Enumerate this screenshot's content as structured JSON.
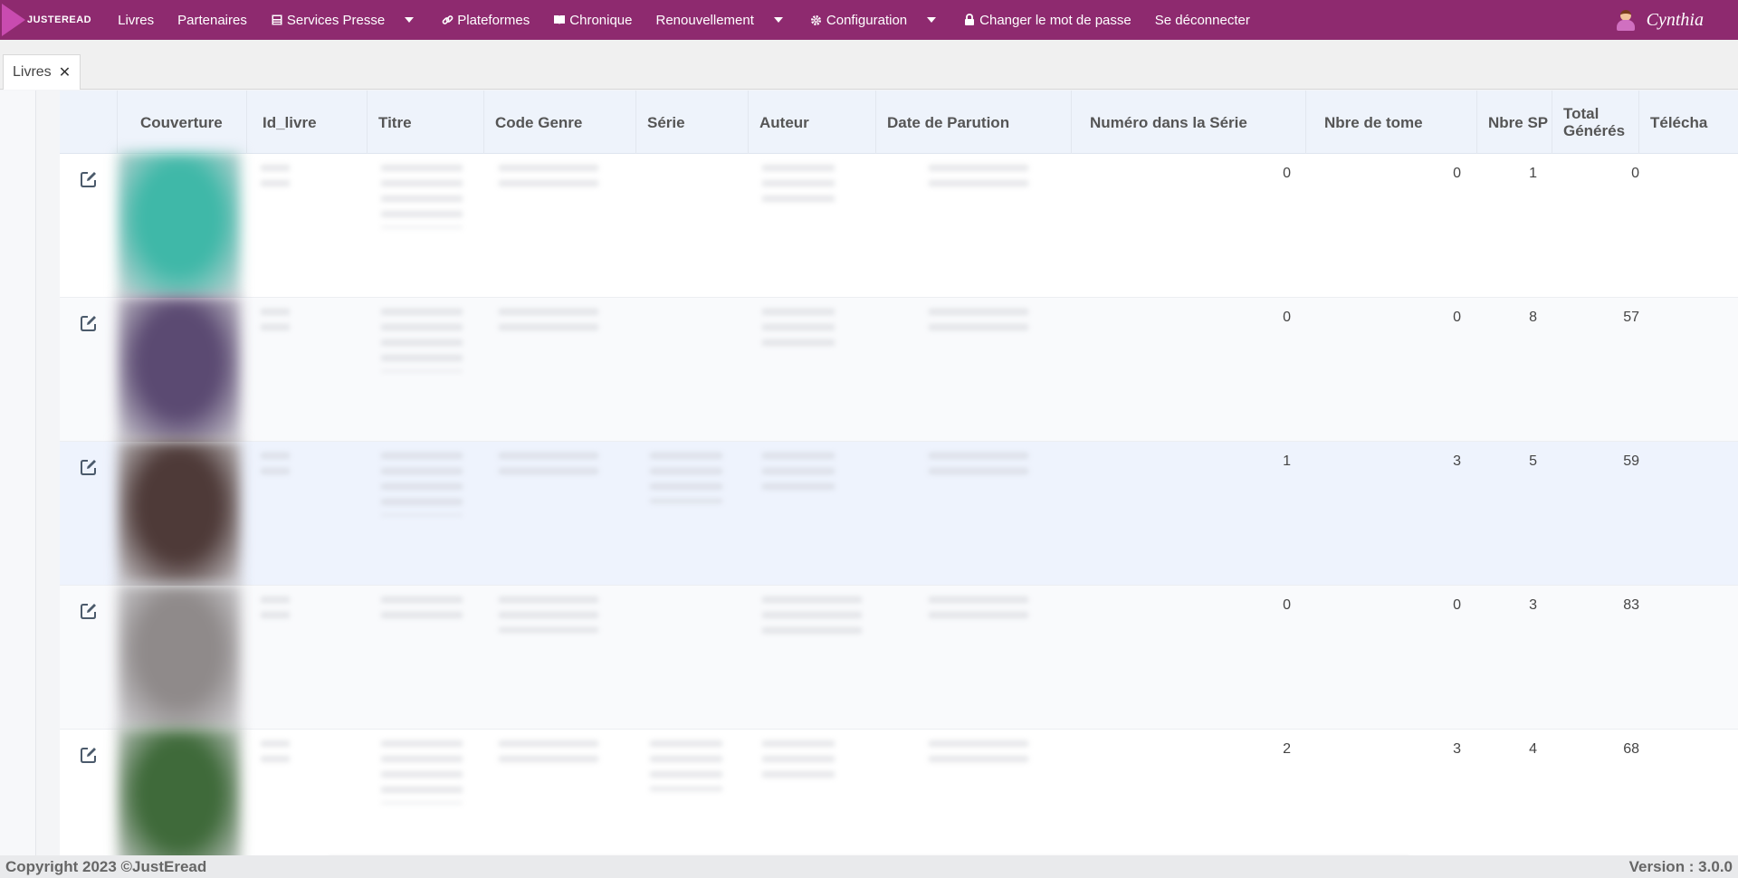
{
  "nav": {
    "logo_text": "JUSTEREAD",
    "items": [
      {
        "label": "Livres"
      },
      {
        "label": "Partenaires"
      },
      {
        "label": "Services Presse",
        "icon": "newspaper-icon",
        "dropdown": true
      },
      {
        "label": "Plateformes",
        "icon": "link-icon"
      },
      {
        "label": "Chronique",
        "icon": "book-icon"
      },
      {
        "label": "Renouvellement",
        "dropdown": true
      },
      {
        "label": "Configuration",
        "icon": "gear-icon",
        "dropdown": true
      },
      {
        "label": "Changer le mot de passe",
        "icon": "lock-icon"
      },
      {
        "label": "Se déconnecter"
      }
    ],
    "user_name": "Cynthia"
  },
  "tabs": [
    {
      "label": "Livres",
      "closable": true
    }
  ],
  "table": {
    "columns": [
      "",
      "Couverture",
      "Id_livre",
      "Titre",
      "Code Genre",
      "Série",
      "Auteur",
      "Date de Parution",
      "Numéro dans la Série",
      "Nbre de tome",
      "Nbre SP",
      "Total Générés",
      "Télécha"
    ],
    "rows": [
      {
        "numero_serie": "0",
        "nbre_tome": "0",
        "nbre_sp": "1",
        "total": "0",
        "cover_color": "#3fb8a8"
      },
      {
        "numero_serie": "0",
        "nbre_tome": "0",
        "nbre_sp": "8",
        "total": "57",
        "cover_color": "#5b4a72"
      },
      {
        "numero_serie": "1",
        "nbre_tome": "3",
        "nbre_sp": "5",
        "total": "59",
        "cover_color": "#4e3a38"
      },
      {
        "numero_serie": "0",
        "nbre_tome": "0",
        "nbre_sp": "3",
        "total": "83",
        "cover_color": "#8f8a8a"
      },
      {
        "numero_serie": "2",
        "nbre_tome": "3",
        "nbre_sp": "4",
        "total": "68",
        "cover_color": "#3f6a3a"
      }
    ]
  },
  "footer": {
    "copyright": "Copyright 2023 ©JustEread",
    "version": "Version : 3.0.0"
  },
  "colors": {
    "navbar": "#8e2a6f",
    "header": "#eef3fb",
    "selected_row": "#eef3fd"
  }
}
